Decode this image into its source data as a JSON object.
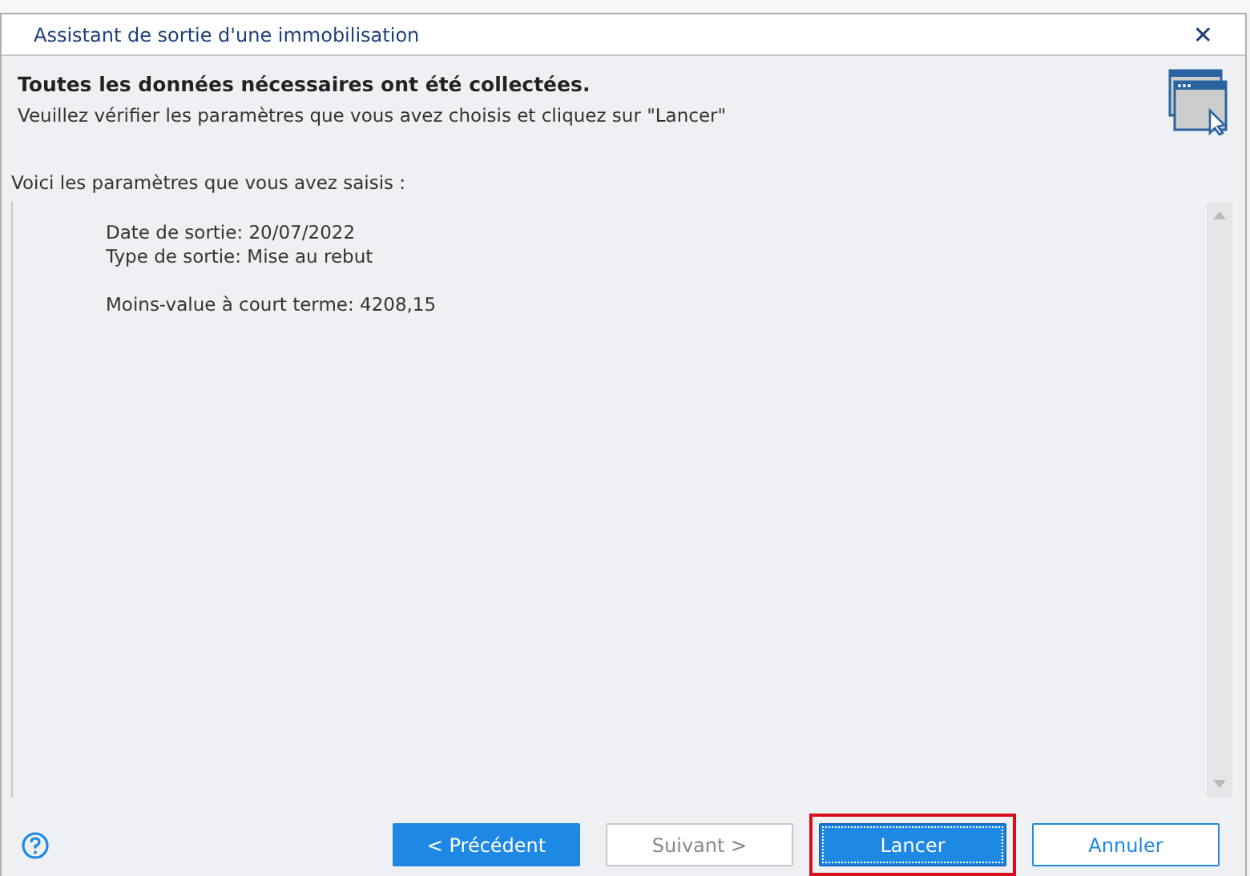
{
  "window": {
    "title": "Assistant de sortie d'une immobilisation",
    "close": "✕"
  },
  "header": {
    "title": "Toutes les données nécessaires ont été collectées.",
    "subtitle": "Veuillez vérifier les paramètres que vous avez choisis et cliquez sur \"Lancer\""
  },
  "intro": "Voici les paramètres que vous avez saisis :",
  "summary_groups": [
    [
      "Date de sortie: 20/07/2022",
      "Type de sortie: Mise au rebut"
    ],
    [
      "Moins-value à court terme: 4208,15"
    ]
  ],
  "buttons": [
    {
      "label": "< Précédent",
      "kind": "primary",
      "disabled": false,
      "highlighted": false
    },
    {
      "label": "Suivant >",
      "kind": "secondary",
      "disabled": true,
      "highlighted": false
    },
    {
      "label": "Lancer",
      "kind": "default",
      "disabled": false,
      "highlighted": true
    },
    {
      "label": "Annuler",
      "kind": "outline",
      "disabled": false,
      "highlighted": false
    }
  ]
}
